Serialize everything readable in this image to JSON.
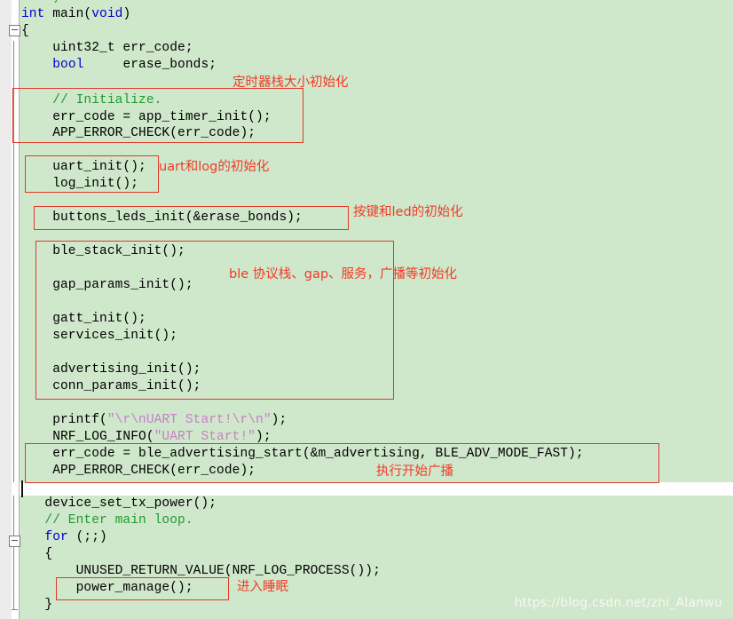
{
  "editor": {
    "language": "c",
    "background_color": "#cfe7cb",
    "comment_color": "#1f9b2f",
    "keyword_color": "#0000c8",
    "string_color": "#c77fc7",
    "annotation_color": "#f43a26"
  },
  "code": {
    "truncated_top_line": "*/",
    "lines": [
      {
        "id": "l01",
        "text": "int main(void)"
      },
      {
        "id": "l02",
        "text": "{"
      },
      {
        "id": "l03",
        "text": "    uint32_t err_code;"
      },
      {
        "id": "l04",
        "text": "    bool     erase_bonds;"
      },
      {
        "id": "l05",
        "text": "    // Initialize."
      },
      {
        "id": "l06",
        "text": "    err_code = app_timer_init();"
      },
      {
        "id": "l07",
        "text": "    APP_ERROR_CHECK(err_code);"
      },
      {
        "id": "l08",
        "text": "    uart_init();"
      },
      {
        "id": "l09",
        "text": "    log_init();"
      },
      {
        "id": "l10",
        "text": "    buttons_leds_init(&erase_bonds);"
      },
      {
        "id": "l11",
        "text": "    ble_stack_init();"
      },
      {
        "id": "l12",
        "text": "    gap_params_init();"
      },
      {
        "id": "l13",
        "text": "    gatt_init();"
      },
      {
        "id": "l14",
        "text": "    services_init();"
      },
      {
        "id": "l15",
        "text": "    advertising_init();"
      },
      {
        "id": "l16",
        "text": "    conn_params_init();"
      },
      {
        "id": "l17",
        "text": "    printf(\"\\r\\nUART Start!\\r\\n\");"
      },
      {
        "id": "l18",
        "text": "    NRF_LOG_INFO(\"UART Start!\");"
      },
      {
        "id": "l19",
        "text": "    err_code = ble_advertising_start(&m_advertising, BLE_ADV_MODE_FAST);"
      },
      {
        "id": "l20",
        "text": "    APP_ERROR_CHECK(err_code);"
      },
      {
        "id": "l21",
        "text": "    device_set_tx_power();"
      },
      {
        "id": "l22",
        "text": "    // Enter main loop."
      },
      {
        "id": "l23",
        "text": "    for (;;)"
      },
      {
        "id": "l24",
        "text": "    {"
      },
      {
        "id": "l25",
        "text": "        UNUSED_RETURN_VALUE(NRF_LOG_PROCESS());"
      },
      {
        "id": "l26",
        "text": "        power_manage();"
      },
      {
        "id": "l27",
        "text": "    }"
      }
    ],
    "tokens": {
      "kw_int": "int",
      "fn_main": " main(",
      "kw_void": "void",
      "paren_close": ")",
      "brace_open": "{",
      "brace_close": "}",
      "decl_uint32": "    uint32_t err_code;",
      "kw_bool": "bool",
      "decl_bool_rest": "     erase_bonds;",
      "cm_initialize": "    // Initialize.",
      "stmt_timer_init": "    err_code = app_timer_init();",
      "stmt_err_check_1": "    APP_ERROR_CHECK(err_code);",
      "stmt_uart_init": "    uart_init();",
      "stmt_log_init": "    log_init();",
      "stmt_buttons": "    buttons_leds_init(&erase_bonds);",
      "stmt_ble_stack": "    ble_stack_init();",
      "stmt_gap_params": "    gap_params_init();",
      "stmt_gatt": "    gatt_init();",
      "stmt_services": "    services_init();",
      "stmt_advertising": "    advertising_init();",
      "stmt_conn_params": "    conn_params_init();",
      "printf_pre": "    printf(",
      "printf_str": "\"\\r\\nUART Start!\\r\\n\"",
      "printf_post": ");",
      "log_pre": "    NRF_LOG_INFO(",
      "log_str": "\"UART Start!\"",
      "log_post": ");",
      "stmt_adv_start": "    err_code = ble_advertising_start(&m_advertising, BLE_ADV_MODE_FAST);",
      "stmt_err_check_2": "    APP_ERROR_CHECK(err_code);",
      "stmt_tx_power": "   device_set_tx_power();",
      "cm_main_loop": "   // Enter main loop.",
      "kw_for": "   for",
      "for_rest": " (;;)",
      "brace_open_2": "   {",
      "stmt_unused_return": "       UNUSED_RETURN_VALUE(NRF_LOG_PROCESS());",
      "stmt_power_manage": "       power_manage();",
      "brace_close_2": "   }"
    }
  },
  "annotations": [
    {
      "id": "a1",
      "text": "定时器栈大小初始化",
      "target": "app_timer_init"
    },
    {
      "id": "a2",
      "text": "uart和log的初始化",
      "target": "uart_log_init"
    },
    {
      "id": "a3",
      "text": "按键和led的初始化",
      "target": "buttons_leds_init"
    },
    {
      "id": "a4",
      "text": "ble 协议栈、gap、服务，广播等初始化",
      "target": "ble_init_group"
    },
    {
      "id": "a5",
      "text": "执行开始广播",
      "target": "ble_advertising_start"
    },
    {
      "id": "a6",
      "text": "进入睡眠",
      "target": "power_manage"
    }
  ],
  "watermark": {
    "text": "https://blog.csdn.net/zhi_Alanwu",
    "edge_fragment": "h"
  }
}
